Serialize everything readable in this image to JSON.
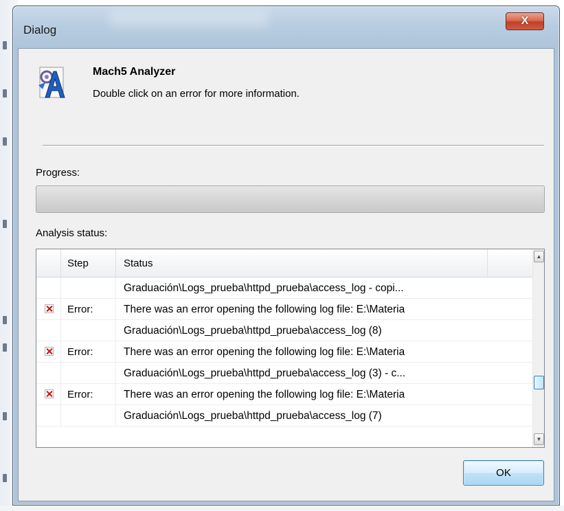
{
  "window": {
    "title": "Dialog",
    "close_glyph": "X"
  },
  "header": {
    "app_name": "Mach5 Analyzer",
    "instruction": "Double click on an error for more information.",
    "icon": "mach5-analyzer-icon"
  },
  "progress": {
    "label": "Progress:",
    "fraction": 0
  },
  "analysis": {
    "label": "Analysis status:",
    "columns": [
      "",
      "Step",
      "Status"
    ],
    "rows": [
      {
        "error": false,
        "step": "",
        "status": "Graduación\\Logs_prueba\\httpd_prueba\\access_log - copi..."
      },
      {
        "error": true,
        "step": "Error:",
        "status": "There was an error opening the following log file: E:\\Materia"
      },
      {
        "error": false,
        "step": "",
        "status": "Graduación\\Logs_prueba\\httpd_prueba\\access_log (8)"
      },
      {
        "error": true,
        "step": "Error:",
        "status": "There was an error opening the following log file: E:\\Materia"
      },
      {
        "error": false,
        "step": "",
        "status": "Graduación\\Logs_prueba\\httpd_prueba\\access_log (3) - c..."
      },
      {
        "error": true,
        "step": "Error:",
        "status": "There was an error opening the following log file: E:\\Materia"
      },
      {
        "error": false,
        "step": "",
        "status": "Graduación\\Logs_prueba\\httpd_prueba\\access_log (7)"
      }
    ]
  },
  "footer": {
    "ok_label": "OK"
  },
  "colors": {
    "error_x": "#d01010",
    "button_border": "#3c7fb1",
    "close_red": "#c0412a"
  }
}
